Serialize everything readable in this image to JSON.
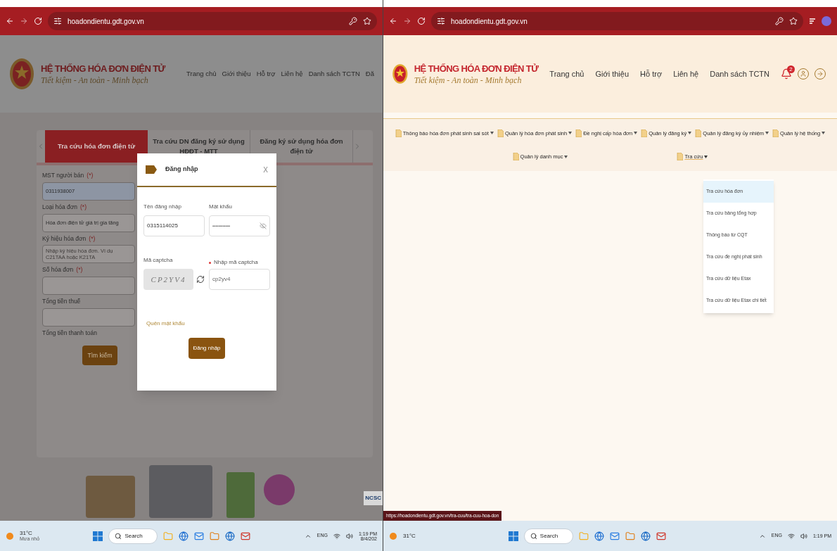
{
  "left_window": {
    "browser": {
      "url": "hoadondientu.gdt.gov.vn"
    },
    "header": {
      "title": "HỆ THỐNG HÓA ĐƠN ĐIỆN TỬ",
      "slogan": "Tiết kiệm - An toàn - Minh bạch",
      "nav": [
        "Trang chủ",
        "Giới thiệu",
        "Hỗ trợ",
        "Liên hệ",
        "Danh sách TCTN",
        "Đă"
      ]
    },
    "tabs": [
      {
        "label": "Tra cứu hóa đơn điện tử",
        "selected": true
      },
      {
        "label": "Tra cứu DN đăng ký sử dụng HĐĐT - MTT",
        "selected": false
      },
      {
        "label": "Đăng ký sử dụng hóa đơn điện tử",
        "selected": false
      }
    ],
    "form": {
      "fields": [
        {
          "label": "MST người bán",
          "required_mark": "(*)",
          "value": "0311938007"
        },
        {
          "label": "Loại hóa đơn",
          "required_mark": "(*)",
          "value": "Hóa đơn điện tử giá trị gia tăng"
        },
        {
          "label": "Ký hiệu hóa đơn",
          "required_mark": "(*)",
          "placeholder": "Nhập ký hiệu hóa đơn. Ví dụ C21TAA hoặc K21TA"
        },
        {
          "label": "Số hóa đơn",
          "required_mark": "(*)"
        },
        {
          "label": "Tổng tiền thuế"
        },
        {
          "label": "Tổng tiền thanh toán"
        }
      ],
      "button": "Tìm kiếm"
    },
    "login_dialog": {
      "title": "Đăng nhập",
      "close": "X",
      "username_label": "Tên đăng nhập",
      "username": "0315114025",
      "password_label": "Mật khẩu",
      "password": "••••••••••••",
      "captcha_label": "Mã captcha",
      "captcha_image": "CP2YV4",
      "captcha_input_label": "Nhập mã captcha",
      "captcha_value": "cp2yv4",
      "forgot": "Quên mật khẩu",
      "submit": "Đăng nhập"
    },
    "badge": "NCSC",
    "taskbar": {
      "temp": "31°C",
      "weather": "Mưa nhỏ",
      "search": "Search",
      "lang": "ENG",
      "time": "1:19 PM",
      "date": "8/4/202"
    }
  },
  "right_window": {
    "browser": {
      "url": "hoadondientu.gdt.gov.vn"
    },
    "header": {
      "title": "HỆ THỐNG HÓA ĐƠN ĐIỆN TỬ",
      "slogan": "Tiết kiệm - An toàn - Minh bạch",
      "nav": [
        "Trang chủ",
        "Giới thiệu",
        "Hỗ trợ",
        "Liên hệ",
        "Danh sách TCTN"
      ],
      "notifications": "2"
    },
    "menu": [
      {
        "label": "Thông báo hóa đơn phát sinh sai sót",
        "expanded": false
      },
      {
        "label": "Quản lý hóa đơn phát sinh",
        "expanded": false
      },
      {
        "label": "Đề nghị cấp hóa đơn",
        "expanded": false
      },
      {
        "label": "Quản lý đăng ký",
        "expanded": false
      },
      {
        "label": "Quản lý đăng ký ủy nhiệm",
        "expanded": false
      },
      {
        "label": "Quản lý hệ thống",
        "expanded": false
      },
      {
        "label": "Quản lý danh mục",
        "expanded": false
      },
      {
        "label": "Tra cứu",
        "expanded": true,
        "children": [
          {
            "label": "Tra cứu hóa đơn",
            "selected": true
          },
          {
            "label": "Tra cứu bảng tổng hợp",
            "selected": false
          },
          {
            "label": "Thông báo từ CQT",
            "selected": false
          },
          {
            "label": "Tra cứu đề nghị phát sinh",
            "selected": false
          },
          {
            "label": "Tra cứu dữ liệu Etax",
            "selected": false
          },
          {
            "label": "Tra cứu dữ liệu Etax chi tiết",
            "selected": false
          }
        ]
      }
    ],
    "status_url": "https://hoadondientu.gdt.gov.vn/tra-cuu/tra-cuu-hoa-don",
    "taskbar": {
      "temp": "31°C",
      "search": "Search",
      "lang": "ENG",
      "time": "1:19 PM"
    }
  }
}
